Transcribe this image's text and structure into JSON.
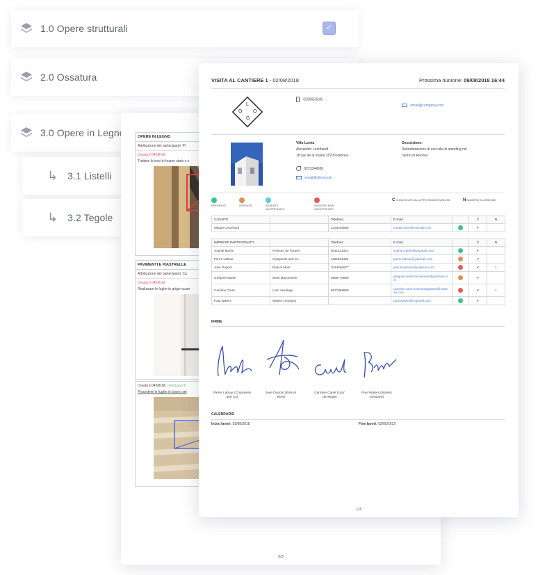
{
  "tasks": [
    {
      "label": "1.0 Opere strutturali",
      "checked": true
    },
    {
      "label": "2.0 Ossatura"
    },
    {
      "label": "3.0 Opere in Legno"
    },
    {
      "label": "3.1 Listelli"
    },
    {
      "label": "3.2 Tegole"
    }
  ],
  "back_page": {
    "section1": {
      "title": "OPERE IN LEGNO",
      "attribution": "Attribuzione dei partecipanti: Pi",
      "created": "Creata il 04/08/18",
      "text": "Trattare le travi in buono stato e s"
    },
    "section2": {
      "title": "PAVIMENTI E PIASTRELLE",
      "attribution": "Attribuzione dei partecipanti: Ca",
      "created": "Creata il 04/08/18",
      "text": "Realizzare le fughe in grigio scuro"
    },
    "section3": {
      "created": "Creata il 04/08/18,",
      "completed": "conclusa il 0",
      "text": "Procedere le fughe in buono sei"
    },
    "page_number": "2/3"
  },
  "front_page": {
    "title": "VISITA AL CANTIERE 1",
    "date": "- 02/08/2018",
    "next_meeting_label": "Prossima riunione:",
    "next_meeting_value": "09/08/2018 16:44",
    "logo_letters": [
      "L",
      "O",
      "G",
      "O"
    ],
    "company_phone": "0290653245",
    "company_email": "email@company.com",
    "client": {
      "name": "Villa Lumia",
      "contact": "Alexander Leonhardt",
      "address": "18 rue de la mairie 35700 Rennes",
      "phone": "0223344556",
      "email": "email@client.com"
    },
    "description_label": "Descrizione:",
    "description": [
      "Ristrutturazione di una villa di standing nel",
      "centro di Rennes"
    ],
    "legend": [
      {
        "label": "PRESENTE",
        "color": "#3cc48a"
      },
      {
        "label": "ASSENTE",
        "color": "#d9925a"
      },
      {
        "label": "ASSENTE GIUSTIFICATO",
        "color": "#5fcfd4"
      },
      {
        "label": "ASSENTE NON GIUSTIFICATO",
        "color": "#e05b5b"
      }
    ],
    "legend_c": "C",
    "legend_c_text": "CONVOCATO ALLA PROSSIMA RIUNIONE",
    "legend_n": "N",
    "legend_n_text": "NUMERO DI ASSENZE",
    "client_table": {
      "headers": [
        "CLIENTE",
        "",
        "Telefono",
        "E-mail",
        "",
        "C",
        "N"
      ],
      "rows": [
        {
          "name": "Megan Leonhardt",
          "company": "",
          "phone": "2233445566",
          "email": "megan.leon@yopmail.com",
          "status": "#3cc48a",
          "c": "✔",
          "n": ""
        }
      ]
    },
    "companies_table": {
      "headers": [
        "IMPRESE PARTECIPANTI",
        "",
        "Telefono",
        "E-mail",
        "",
        "C",
        "N"
      ],
      "rows": [
        {
          "name": "Sophie Martin",
          "company": "Peinture de l'Ouest",
          "phone": "0011223344",
          "email": "sophie.martin@yopmail.com",
          "status": "#3cc48a",
          "c": "✔",
          "n": ""
        },
        {
          "name": "Pierre Labour",
          "company": "Charpente and Co",
          "phone": "1122334455",
          "email": "pierre.labour@yopmail.com",
          "status": "#d9925a",
          "c": "✔",
          "n": ""
        },
        {
          "name": "Jose Dupont",
          "company": "Bois et Murs",
          "phone": "3344556677",
          "email": "jose.boismurs@yopmail.com",
          "status": "#e05b5b",
          "c": "✔",
          "n": "1"
        },
        {
          "name": "Grégoire Martin",
          "company": "West Maconnerie",
          "phone": "5566778899",
          "email": "gregoire.westmaconnerie@yopmail.com",
          "status": "#d9925a",
          "c": "✔",
          "n": ""
        },
        {
          "name": "Caroline Carré",
          "company": "Lios' carrelage",
          "phone": "6677889900",
          "email": "caroline.carre.lioscarrelage623@yopmail.com",
          "status": "#e05b5b",
          "c": "✔",
          "n": "1"
        },
        {
          "name": "Paul Waters",
          "company": "Waters company",
          "phone": "",
          "email": "paul.waters@yopmail.com",
          "status": "#3cc48a",
          "c": "✔",
          "n": ""
        }
      ]
    },
    "signatures_title": "FIRME",
    "signatures": [
      {
        "name": [
          "Pierre Labour (Charpente",
          "and Co)"
        ]
      },
      {
        "name": [
          "Jose Dupont (Bois et",
          "Murs)"
        ]
      },
      {
        "name": [
          "Caroline Carré (Lios'",
          "carrelage)"
        ]
      },
      {
        "name": [
          "Paul Waters (Waters",
          "company)"
        ]
      }
    ],
    "calendar_title": "CALENDARIO",
    "start_label": "Inizio lavori:",
    "start_value": "02/08/2018",
    "end_label": "Fine lavori:",
    "end_value": "02/05/2019",
    "page_number": "1/3"
  }
}
